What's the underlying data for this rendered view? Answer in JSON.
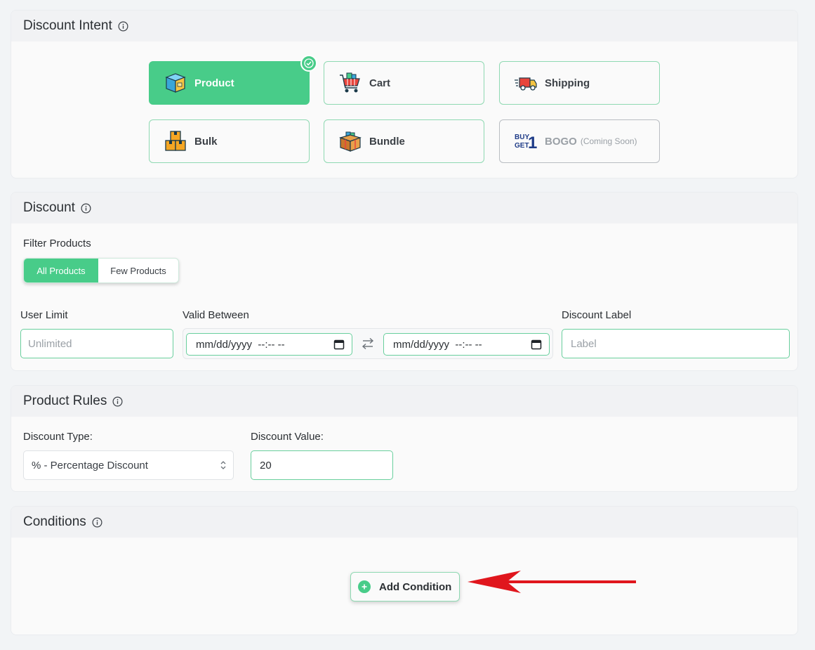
{
  "intent": {
    "title": "Discount Intent",
    "tiles": [
      {
        "label": "Product",
        "icon": "product-box-icon",
        "active": true
      },
      {
        "label": "Cart",
        "icon": "shopping-cart-icon"
      },
      {
        "label": "Shipping",
        "icon": "delivery-truck-icon"
      },
      {
        "label": "Bulk",
        "icon": "stacked-boxes-icon"
      },
      {
        "label": "Bundle",
        "icon": "bundle-box-icon"
      },
      {
        "label": "BOGO",
        "note": "(Coming Soon)",
        "icon": "buy-get-one-icon",
        "disabled": true,
        "icon_text_top": "BUY",
        "icon_text_bottom": "GET",
        "icon_number": "1"
      }
    ]
  },
  "discount": {
    "title": "Discount",
    "filter_label": "Filter Products",
    "filter_options": [
      "All Products",
      "Few Products"
    ],
    "user_limit_label": "User Limit",
    "user_limit_placeholder": "Unlimited",
    "valid_between_label": "Valid Between",
    "date_start": "mm/dd/yyyy  --:-- --",
    "date_end": "mm/dd/yyyy  --:-- --",
    "discount_label_label": "Discount Label",
    "discount_label_placeholder": "Label"
  },
  "rules": {
    "title": "Product Rules",
    "type_label": "Discount Type:",
    "type_value": "% - Percentage Discount",
    "value_label": "Discount Value:",
    "value": "20"
  },
  "conditions": {
    "title": "Conditions",
    "add_label": "Add Condition"
  },
  "colors": {
    "accent": "#48cc89",
    "arrow": "#e0161d"
  }
}
